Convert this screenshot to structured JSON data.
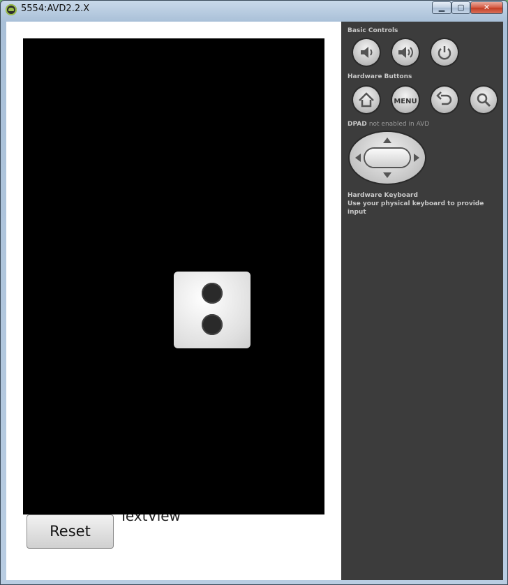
{
  "window": {
    "title": "5554:AVD2.2.X",
    "minimize_symbol": "▁",
    "maximize_symbol": "▢",
    "close_symbol": "✕"
  },
  "app": {
    "reset_label": "Reset",
    "textview_label": "TextView",
    "die_face_value": 2
  },
  "panel": {
    "basic_controls_label": "Basic Controls",
    "hardware_buttons_label": "Hardware Buttons",
    "dpad_label": "DPAD",
    "dpad_note": "not enabled in AVD",
    "keyboard_title": "Hardware Keyboard",
    "keyboard_note": "Use your physical keyboard to provide input",
    "menu_label": "MENU",
    "basic_controls": [
      {
        "icon": "volume-down-icon"
      },
      {
        "icon": "volume-up-icon"
      },
      {
        "icon": "power-icon"
      }
    ],
    "hardware_buttons": [
      {
        "icon": "home-icon"
      },
      {
        "icon": "menu-icon"
      },
      {
        "icon": "back-icon"
      },
      {
        "icon": "search-icon"
      }
    ]
  }
}
